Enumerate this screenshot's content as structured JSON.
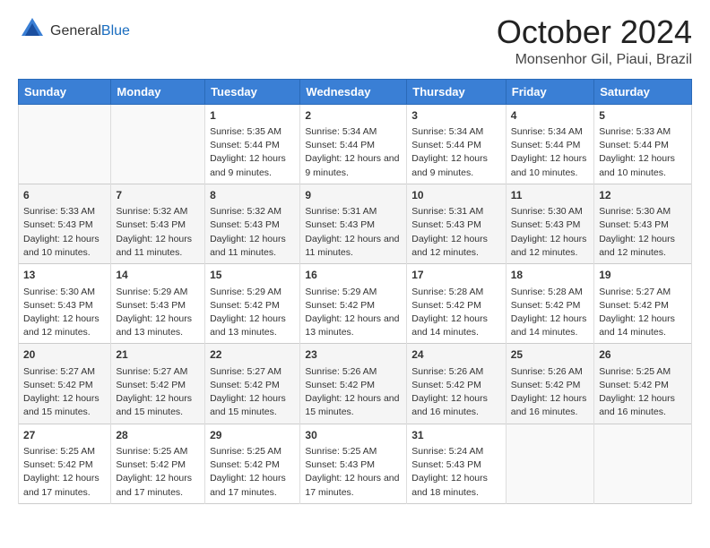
{
  "logo": {
    "general": "General",
    "blue": "Blue"
  },
  "header": {
    "month": "October 2024",
    "location": "Monsenhor Gil, Piaui, Brazil"
  },
  "days_of_week": [
    "Sunday",
    "Monday",
    "Tuesday",
    "Wednesday",
    "Thursday",
    "Friday",
    "Saturday"
  ],
  "weeks": [
    [
      {
        "day": "",
        "sunrise": "",
        "sunset": "",
        "daylight": ""
      },
      {
        "day": "",
        "sunrise": "",
        "sunset": "",
        "daylight": ""
      },
      {
        "day": "1",
        "sunrise": "Sunrise: 5:35 AM",
        "sunset": "Sunset: 5:44 PM",
        "daylight": "Daylight: 12 hours and 9 minutes."
      },
      {
        "day": "2",
        "sunrise": "Sunrise: 5:34 AM",
        "sunset": "Sunset: 5:44 PM",
        "daylight": "Daylight: 12 hours and 9 minutes."
      },
      {
        "day": "3",
        "sunrise": "Sunrise: 5:34 AM",
        "sunset": "Sunset: 5:44 PM",
        "daylight": "Daylight: 12 hours and 9 minutes."
      },
      {
        "day": "4",
        "sunrise": "Sunrise: 5:34 AM",
        "sunset": "Sunset: 5:44 PM",
        "daylight": "Daylight: 12 hours and 10 minutes."
      },
      {
        "day": "5",
        "sunrise": "Sunrise: 5:33 AM",
        "sunset": "Sunset: 5:44 PM",
        "daylight": "Daylight: 12 hours and 10 minutes."
      }
    ],
    [
      {
        "day": "6",
        "sunrise": "Sunrise: 5:33 AM",
        "sunset": "Sunset: 5:43 PM",
        "daylight": "Daylight: 12 hours and 10 minutes."
      },
      {
        "day": "7",
        "sunrise": "Sunrise: 5:32 AM",
        "sunset": "Sunset: 5:43 PM",
        "daylight": "Daylight: 12 hours and 11 minutes."
      },
      {
        "day": "8",
        "sunrise": "Sunrise: 5:32 AM",
        "sunset": "Sunset: 5:43 PM",
        "daylight": "Daylight: 12 hours and 11 minutes."
      },
      {
        "day": "9",
        "sunrise": "Sunrise: 5:31 AM",
        "sunset": "Sunset: 5:43 PM",
        "daylight": "Daylight: 12 hours and 11 minutes."
      },
      {
        "day": "10",
        "sunrise": "Sunrise: 5:31 AM",
        "sunset": "Sunset: 5:43 PM",
        "daylight": "Daylight: 12 hours and 12 minutes."
      },
      {
        "day": "11",
        "sunrise": "Sunrise: 5:30 AM",
        "sunset": "Sunset: 5:43 PM",
        "daylight": "Daylight: 12 hours and 12 minutes."
      },
      {
        "day": "12",
        "sunrise": "Sunrise: 5:30 AM",
        "sunset": "Sunset: 5:43 PM",
        "daylight": "Daylight: 12 hours and 12 minutes."
      }
    ],
    [
      {
        "day": "13",
        "sunrise": "Sunrise: 5:30 AM",
        "sunset": "Sunset: 5:43 PM",
        "daylight": "Daylight: 12 hours and 12 minutes."
      },
      {
        "day": "14",
        "sunrise": "Sunrise: 5:29 AM",
        "sunset": "Sunset: 5:43 PM",
        "daylight": "Daylight: 12 hours and 13 minutes."
      },
      {
        "day": "15",
        "sunrise": "Sunrise: 5:29 AM",
        "sunset": "Sunset: 5:42 PM",
        "daylight": "Daylight: 12 hours and 13 minutes."
      },
      {
        "day": "16",
        "sunrise": "Sunrise: 5:29 AM",
        "sunset": "Sunset: 5:42 PM",
        "daylight": "Daylight: 12 hours and 13 minutes."
      },
      {
        "day": "17",
        "sunrise": "Sunrise: 5:28 AM",
        "sunset": "Sunset: 5:42 PM",
        "daylight": "Daylight: 12 hours and 14 minutes."
      },
      {
        "day": "18",
        "sunrise": "Sunrise: 5:28 AM",
        "sunset": "Sunset: 5:42 PM",
        "daylight": "Daylight: 12 hours and 14 minutes."
      },
      {
        "day": "19",
        "sunrise": "Sunrise: 5:27 AM",
        "sunset": "Sunset: 5:42 PM",
        "daylight": "Daylight: 12 hours and 14 minutes."
      }
    ],
    [
      {
        "day": "20",
        "sunrise": "Sunrise: 5:27 AM",
        "sunset": "Sunset: 5:42 PM",
        "daylight": "Daylight: 12 hours and 15 minutes."
      },
      {
        "day": "21",
        "sunrise": "Sunrise: 5:27 AM",
        "sunset": "Sunset: 5:42 PM",
        "daylight": "Daylight: 12 hours and 15 minutes."
      },
      {
        "day": "22",
        "sunrise": "Sunrise: 5:27 AM",
        "sunset": "Sunset: 5:42 PM",
        "daylight": "Daylight: 12 hours and 15 minutes."
      },
      {
        "day": "23",
        "sunrise": "Sunrise: 5:26 AM",
        "sunset": "Sunset: 5:42 PM",
        "daylight": "Daylight: 12 hours and 15 minutes."
      },
      {
        "day": "24",
        "sunrise": "Sunrise: 5:26 AM",
        "sunset": "Sunset: 5:42 PM",
        "daylight": "Daylight: 12 hours and 16 minutes."
      },
      {
        "day": "25",
        "sunrise": "Sunrise: 5:26 AM",
        "sunset": "Sunset: 5:42 PM",
        "daylight": "Daylight: 12 hours and 16 minutes."
      },
      {
        "day": "26",
        "sunrise": "Sunrise: 5:25 AM",
        "sunset": "Sunset: 5:42 PM",
        "daylight": "Daylight: 12 hours and 16 minutes."
      }
    ],
    [
      {
        "day": "27",
        "sunrise": "Sunrise: 5:25 AM",
        "sunset": "Sunset: 5:42 PM",
        "daylight": "Daylight: 12 hours and 17 minutes."
      },
      {
        "day": "28",
        "sunrise": "Sunrise: 5:25 AM",
        "sunset": "Sunset: 5:42 PM",
        "daylight": "Daylight: 12 hours and 17 minutes."
      },
      {
        "day": "29",
        "sunrise": "Sunrise: 5:25 AM",
        "sunset": "Sunset: 5:42 PM",
        "daylight": "Daylight: 12 hours and 17 minutes."
      },
      {
        "day": "30",
        "sunrise": "Sunrise: 5:25 AM",
        "sunset": "Sunset: 5:43 PM",
        "daylight": "Daylight: 12 hours and 17 minutes."
      },
      {
        "day": "31",
        "sunrise": "Sunrise: 5:24 AM",
        "sunset": "Sunset: 5:43 PM",
        "daylight": "Daylight: 12 hours and 18 minutes."
      },
      {
        "day": "",
        "sunrise": "",
        "sunset": "",
        "daylight": ""
      },
      {
        "day": "",
        "sunrise": "",
        "sunset": "",
        "daylight": ""
      }
    ]
  ]
}
